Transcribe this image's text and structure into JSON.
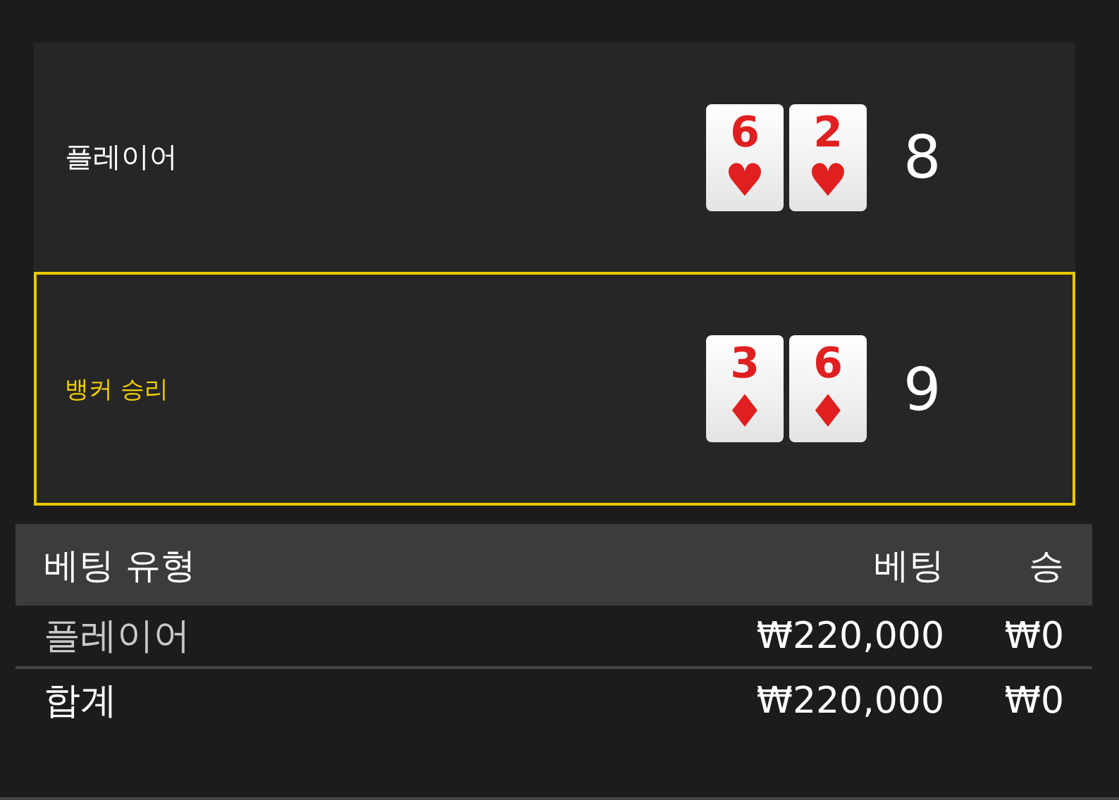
{
  "hands": [
    {
      "label": "플레이어",
      "winner": false,
      "score": "8",
      "cards": [
        {
          "rank": "6",
          "suit": "♥"
        },
        {
          "rank": "2",
          "suit": "♥"
        }
      ]
    },
    {
      "label": "뱅커 승리",
      "winner": true,
      "score": "9",
      "cards": [
        {
          "rank": "3",
          "suit": "♦"
        },
        {
          "rank": "6",
          "suit": "♦"
        }
      ]
    }
  ],
  "bets_table": {
    "columns": [
      "베팅 유형",
      "베팅",
      "승"
    ],
    "rows": [
      {
        "kind": "bet",
        "cells": [
          "플레이어",
          "₩220,000",
          "₩0"
        ]
      },
      {
        "kind": "total",
        "cells": [
          "합계",
          "₩220,000",
          "₩0"
        ]
      }
    ]
  }
}
